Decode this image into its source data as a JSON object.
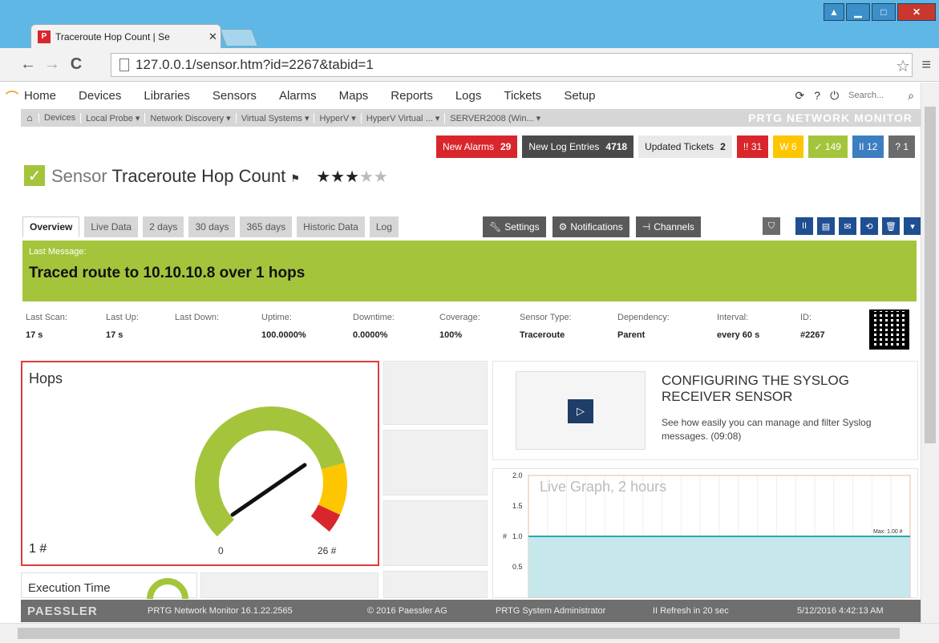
{
  "browser": {
    "tab_title": "Traceroute Hop Count | Se",
    "favicon_text": "P",
    "url": "127.0.0.1/sensor.htm?id=2267&tabid=1"
  },
  "nav": {
    "items": [
      "Home",
      "Devices",
      "Libraries",
      "Sensors",
      "Alarms",
      "Maps",
      "Reports",
      "Logs",
      "Tickets",
      "Setup"
    ],
    "search_placeholder": "Search..."
  },
  "breadcrumb": {
    "items": [
      "Devices",
      "Local Probe ▾",
      "Network Discovery ▾",
      "Virtual Systems ▾",
      "HyperV ▾",
      "HyperV Virtual ... ▾",
      "SERVER2008 (Win... ▾"
    ],
    "brand": "PRTG NETWORK MONITOR"
  },
  "alerts": {
    "new_alarms_label": "New Alarms",
    "new_alarms_count": "29",
    "new_log_label": "New Log Entries",
    "new_log_count": "4718",
    "tickets_label": "Updated Tickets",
    "tickets_count": "2",
    "down": "!! 31",
    "warning": "W 6",
    "up": "✓ 149",
    "paused": "II 12",
    "unknown": "? 1"
  },
  "sensor": {
    "label": "Sensor",
    "name": "Traceroute Hop Count",
    "priority_stars": 3,
    "priority_max": 5
  },
  "tabs": [
    "Overview",
    "Live Data",
    "2 days",
    "30 days",
    "365 days",
    "Historic Data",
    "Log"
  ],
  "actions": [
    "Settings",
    "Notifications",
    "Channels"
  ],
  "message": {
    "label": "Last Message:",
    "text": "Traced route to 10.10.10.8 over 1 hops"
  },
  "stats": [
    {
      "label": "Last Scan:",
      "value": "17 s"
    },
    {
      "label": "Last Up:",
      "value": "17 s"
    },
    {
      "label": "Last Down:",
      "value": ""
    },
    {
      "label": "Uptime:",
      "value": "100.0000%"
    },
    {
      "label": "Downtime:",
      "value": "0.0000%"
    },
    {
      "label": "Coverage:",
      "value": "100%"
    },
    {
      "label": "Sensor Type:",
      "value": "Traceroute"
    },
    {
      "label": "Dependency:",
      "value": "Parent"
    },
    {
      "label": "Interval:",
      "value": "every 60 s"
    },
    {
      "label": "ID:",
      "value": "#2267"
    }
  ],
  "gauge": {
    "title": "Hops",
    "value": "1 #",
    "min": "0",
    "max": "26 #",
    "colors": {
      "ok": "#a4c53b",
      "warning": "#fdc600",
      "error": "#d9262c"
    }
  },
  "video": {
    "title": "CONFIGURING THE SYSLOG RECEIVER SENSOR",
    "description": "See how easily you can manage and filter Syslog messages. (09:08)"
  },
  "live_graph": {
    "title": "Live Graph, 2 hours",
    "max_label": "Max: 1.00 #",
    "y_ticks": [
      "2.0",
      "1.5",
      "1.0",
      "0.5"
    ],
    "y_unit": "#",
    "value": 1.0,
    "ylim": [
      0,
      2.0
    ]
  },
  "execution": {
    "title": "Execution Time"
  },
  "footer": {
    "logo": "PAESSLER",
    "version": "PRTG Network Monitor 16.1.22.2565",
    "copyright": "© 2016 Paessler AG",
    "user": "PRTG System Administrator",
    "refresh": "II Refresh in 20 sec",
    "datetime": "5/12/2016 4:42:13 AM"
  },
  "colors": {
    "accent_green": "#a4c53b",
    "alarm_red": "#d9262c",
    "titlebar_blue": "#5fb7e5"
  }
}
